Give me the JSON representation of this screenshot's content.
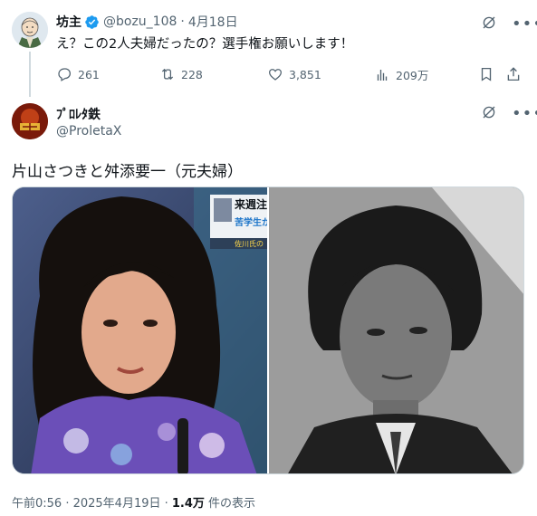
{
  "reply_tweet": {
    "display_name": "坊主",
    "handle": "@bozu_108",
    "separator": "·",
    "date": "4月18日",
    "text": "え？この2人夫婦だったの？選手権お願いします！",
    "stats": {
      "replies": "261",
      "retweets": "228",
      "likes": "3,851",
      "views": "209万"
    }
  },
  "main_tweet": {
    "display_name": "ﾌﾟﾛﾚﾀ鉄",
    "handle": "@ProletaX",
    "text": "片山さつきと舛添要一（元夫婦）",
    "timestamp": "午前0:56 · 2025年4月19日 · ",
    "view_count": "1.4万",
    "view_suffix": " 件の表示"
  },
  "media": {
    "left_overlay_line1": "来週注",
    "left_overlay_line2": "苦学生か",
    "left_overlay_line3": "佐川氏の"
  },
  "colors": {
    "text": "#0f1419",
    "muted": "#536471",
    "verified": "#1d9bf0",
    "border": "#cfd9de"
  },
  "icons": [
    "verified-badge-icon",
    "grok-icon",
    "more-icon",
    "reply-icon",
    "retweet-icon",
    "like-icon",
    "views-icon",
    "bookmark-icon",
    "share-icon"
  ]
}
